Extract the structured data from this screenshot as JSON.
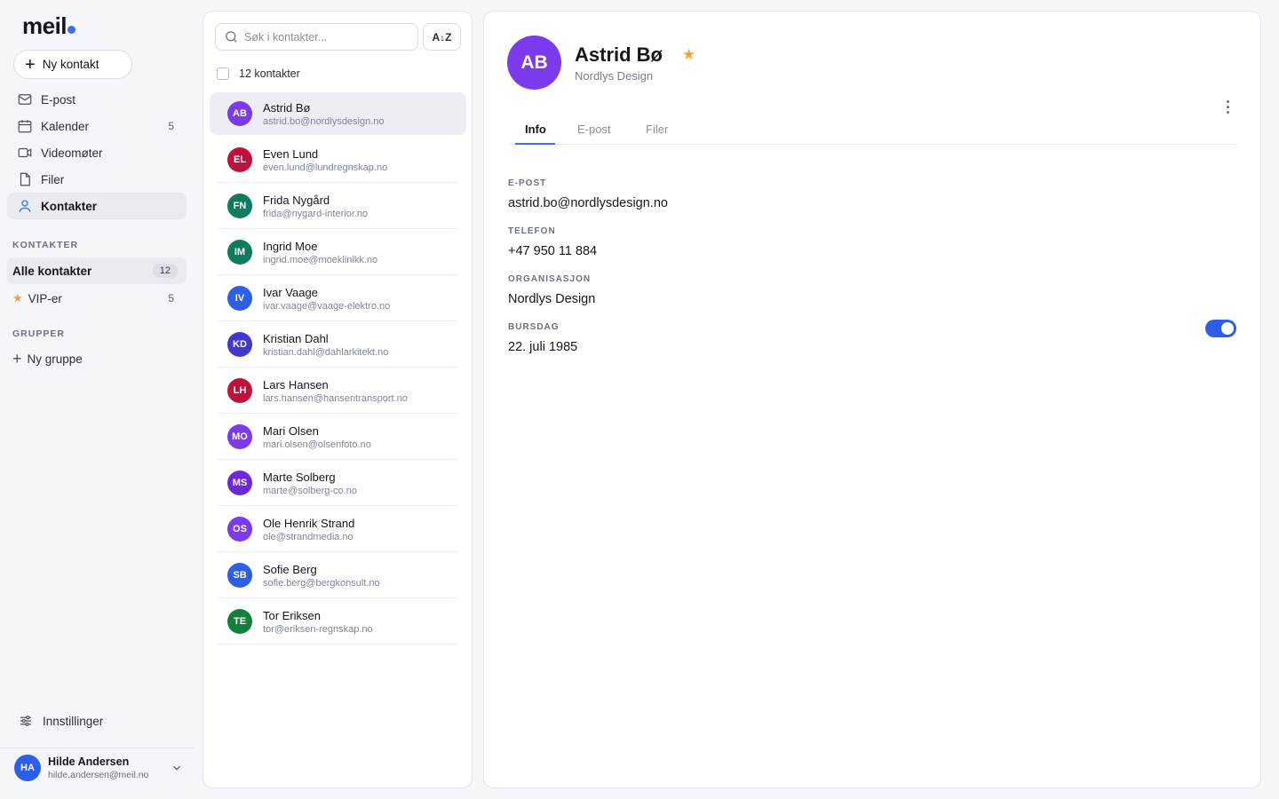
{
  "app": {
    "logo_text": "meil"
  },
  "sidebar": {
    "new_contact_label": "Ny kontakt",
    "nav": [
      {
        "label": "E-post",
        "icon": "mail-icon",
        "count": ""
      },
      {
        "label": "Kalender",
        "icon": "calendar-icon",
        "count": "5"
      },
      {
        "label": "Videomøter",
        "icon": "video-icon",
        "count": ""
      },
      {
        "label": "Filer",
        "icon": "file-icon",
        "count": ""
      },
      {
        "label": "Kontakter",
        "icon": "person-icon",
        "count": ""
      }
    ],
    "contacts_section": "KONTAKTER",
    "all_contacts": {
      "label": "Alle kontakter",
      "count": "12"
    },
    "vip": {
      "label": "VIP-er",
      "count": "5"
    },
    "groups_section": "GRUPPER",
    "new_group_label": "Ny gruppe",
    "settings_label": "Innstillinger",
    "user": {
      "initials": "HA",
      "name": "Hilde Andersen",
      "email": "hilde.andersen@meil.no"
    }
  },
  "list": {
    "search_placeholder": "Søk i kontakter...",
    "sort_label": "A↓Z",
    "count_label": "12 kontakter",
    "contacts": [
      {
        "initials": "AB",
        "name": "Astrid Bø",
        "email": "astrid.bo@nordlysdesign.no",
        "color": "#7c3aed"
      },
      {
        "initials": "EL",
        "name": "Even Lund",
        "email": "even.lund@lundregnskap.no",
        "color": "#be123c"
      },
      {
        "initials": "FN",
        "name": "Frida Nygård",
        "email": "frida@nygard-interior.no",
        "color": "#0f7b5f"
      },
      {
        "initials": "IM",
        "name": "Ingrid Moe",
        "email": "ingrid.moe@moeklinikk.no",
        "color": "#0f7b5f"
      },
      {
        "initials": "IV",
        "name": "Ivar Vaage",
        "email": "ivar.vaage@vaage-elektro.no",
        "color": "#2d5ee8"
      },
      {
        "initials": "KD",
        "name": "Kristian Dahl",
        "email": "kristian.dahl@dahlarkitekt.no",
        "color": "#4338ca"
      },
      {
        "initials": "LH",
        "name": "Lars Hansen",
        "email": "lars.hansen@hansentransport.no",
        "color": "#be123c"
      },
      {
        "initials": "MO",
        "name": "Mari Olsen",
        "email": "mari.olsen@olsenfoto.no",
        "color": "#7c3aed"
      },
      {
        "initials": "MS",
        "name": "Marte Solberg",
        "email": "marte@solberg-co.no",
        "color": "#6d28d9"
      },
      {
        "initials": "OS",
        "name": "Ole Henrik Strand",
        "email": "ole@strandmedia.no",
        "color": "#7c3aed"
      },
      {
        "initials": "SB",
        "name": "Sofie Berg",
        "email": "sofie.berg@bergkonsult.no",
        "color": "#2d5ee8"
      },
      {
        "initials": "TE",
        "name": "Tor Eriksen",
        "email": "tor@eriksen-regnskap.no",
        "color": "#15803d"
      }
    ]
  },
  "detail": {
    "initials": "AB",
    "name": "Astrid Bø",
    "organization": "Nordlys Design",
    "tabs": [
      "Info",
      "E-post",
      "Filer"
    ],
    "fields": {
      "email_label": "E-POST",
      "email_value": "astrid.bo@nordlysdesign.no",
      "phone_label": "TELEFON",
      "phone_value": "+47 950 11 884",
      "org_label": "ORGANISASJON",
      "org_value": "Nordlys Design",
      "birthday_label": "BURSDAG",
      "birthday_value": "22. juli 1985"
    }
  },
  "colors": {
    "accent": "#3f6df1",
    "star": "#f0a53a"
  }
}
